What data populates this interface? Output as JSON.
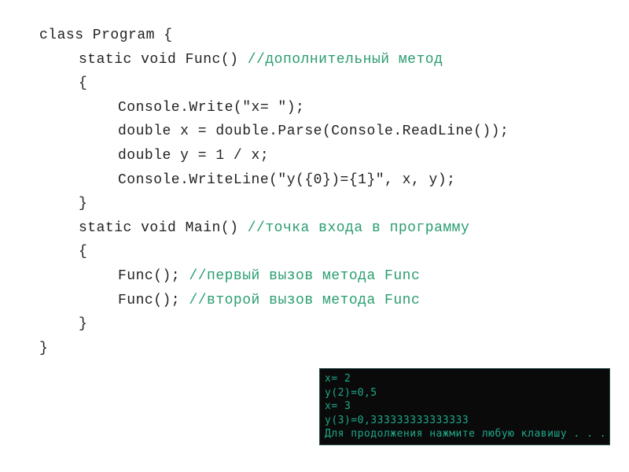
{
  "code": {
    "l1": "class Program    {",
    "l2a": "static void Func()   ",
    "l2b": "//дополнительный метод",
    "l3": "{",
    "l4": "Console.Write(\"x= \");",
    "l5": "double x = double.Parse(Console.ReadLine());",
    "l6": "double y = 1 / x;",
    "l7": "Console.WriteLine(\"y({0})={1}\", x, y);",
    "l8": "}",
    "l9a": "static void Main()   ",
    "l9b": "//точка входа в программу",
    "l10": "{",
    "l11a": "Func();  ",
    "l11b": "//первый вызов метода Func",
    "l12a": "Func();  ",
    "l12b": "//второй вызов метода Func",
    "l13": "}",
    "l14": "}"
  },
  "console": {
    "r1": "x= 2",
    "r2": "y(2)=0,5",
    "r3": "x= 3",
    "r4": "y(3)=0,333333333333333",
    "r5": "Для продолжения нажмите любую клавишу . . ."
  }
}
